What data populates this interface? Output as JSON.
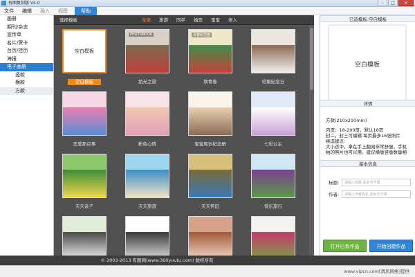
{
  "window": {
    "title": "有图复刻版 V4.0",
    "controls": [
      "–",
      "□",
      "✕"
    ]
  },
  "menu": {
    "items": [
      {
        "label": "文件",
        "state": "normal"
      },
      {
        "label": "编辑",
        "state": "normal"
      },
      {
        "label": "插入",
        "state": "disabled"
      },
      {
        "label": "视图",
        "state": "disabled"
      },
      {
        "label": "帮助",
        "state": "active"
      }
    ]
  },
  "sidebar": {
    "items": [
      {
        "label": "画册",
        "type": "item"
      },
      {
        "label": "期刊/杂志",
        "type": "item"
      },
      {
        "label": "宣传单",
        "type": "item"
      },
      {
        "label": "名片/贺卡",
        "type": "item"
      },
      {
        "label": "台历/挂历",
        "type": "item"
      },
      {
        "label": "海报",
        "type": "item"
      },
      {
        "label": "电子画册",
        "type": "active"
      },
      {
        "label": "竖款",
        "type": "sub"
      },
      {
        "label": "横款",
        "type": "sub"
      },
      {
        "label": "方款",
        "type": "sub-selected"
      }
    ]
  },
  "gallery": {
    "header_label": "选择模板",
    "filters": [
      {
        "label": "全部",
        "active": true
      },
      {
        "label": "旅游",
        "active": false
      },
      {
        "label": "同学",
        "active": false
      },
      {
        "label": "婚恋",
        "active": false
      },
      {
        "label": "宝宝",
        "active": false
      },
      {
        "label": "老人",
        "active": false
      }
    ],
    "templates": [
      {
        "caption": "空白模板",
        "inner_text": "空白模板",
        "selected": true,
        "palette": [
          "#ffffff",
          "#ffffff",
          "#ffffff"
        ]
      },
      {
        "caption": "拍光之旅",
        "inner_text": "PHOTOBOOK",
        "selected": false,
        "palette": [
          "#d9d2c4",
          "#7d6a4f",
          "#bf3f3a"
        ]
      },
      {
        "caption": "致青春",
        "inner_text": "青春纪念册",
        "selected": false,
        "palette": [
          "#efe8c8",
          "#3f8f4a",
          "#c7413b"
        ]
      },
      {
        "caption": "结婚纪念日",
        "inner_text": "",
        "selected": false,
        "palette": [
          "#ece6e0",
          "#8a6a55",
          "#f2f0ee"
        ]
      },
      {
        "caption": "恋爱那点事",
        "inner_text": "",
        "selected": false,
        "palette": [
          "#f7d6e6",
          "#e77fb0",
          "#5a8bd6"
        ]
      },
      {
        "caption": "粉色心情",
        "inner_text": "",
        "selected": false,
        "palette": [
          "#f7e3e8",
          "#f2c6b0",
          "#e2a0b8"
        ]
      },
      {
        "caption": "宝宝周岁纪念册",
        "inner_text": "",
        "selected": false,
        "palette": [
          "#fbf4ea",
          "#e9cfb2",
          "#8a6d55"
        ]
      },
      {
        "caption": "七彩公主",
        "inner_text": "",
        "selected": false,
        "palette": [
          "#dfe9f7",
          "#ffffff",
          "#c9a0d8"
        ]
      },
      {
        "caption": "天天亲子",
        "inner_text": "",
        "selected": false,
        "palette": [
          "#8cc86c",
          "#3e8c3a",
          "#f0d94a"
        ]
      },
      {
        "caption": "天天旅游",
        "inner_text": "",
        "selected": false,
        "palette": [
          "#9ed6f0",
          "#3a8fc8",
          "#f2e3c2"
        ]
      },
      {
        "caption": "天天怀旧",
        "inner_text": "",
        "selected": false,
        "palette": [
          "#d7c07a",
          "#7a6a3a",
          "#3a78b8"
        ]
      },
      {
        "caption": "快乐旅行",
        "inner_text": "",
        "selected": false,
        "palette": [
          "#cfe7f5",
          "#7b3f8f",
          "#5a9a4a"
        ]
      },
      {
        "caption": "",
        "inner_text": "",
        "selected": false,
        "palette": [
          "#e3ecd6",
          "#4a4a4a",
          "#f0f0f0"
        ]
      },
      {
        "caption": "",
        "inner_text": "",
        "selected": false,
        "palette": [
          "#ffffff",
          "#3a3a3a",
          "#dedede"
        ]
      },
      {
        "caption": "",
        "inner_text": "",
        "selected": false,
        "palette": [
          "#d6a38a",
          "#a35a3a",
          "#f0d8c6"
        ]
      },
      {
        "caption": "",
        "inner_text": "",
        "selected": false,
        "palette": [
          "#f4f2ee",
          "#c43a6a",
          "#7da04a"
        ]
      }
    ]
  },
  "right_panel": {
    "selected_head": "已选模板:空白模板",
    "preview_text": "空白模板",
    "details_head": "详情",
    "details_lines": [
      "方款(210x210mm)",
      "内页：18-200页，默认18页",
      "封二，封三可编辑,每页最多16张照片",
      "挑选建议:",
      "大小适中，拿在手上翻阅非常舒服，手机",
      "拍的照片也可以用。建议横版竖版数量相"
    ],
    "info_head": "基本信息",
    "title_label": "标题:",
    "title_placeholder": "请输入标题 此处可不填",
    "author_label": "作者:",
    "author_placeholder": "请输入作者姓名 此处可不填",
    "open_button": "打开已有作品",
    "create_button": "开始创建作品"
  },
  "footer": {
    "copyright": "© 2003-2013 有图网(www.360youtu.com) 版权所有",
    "watermark": "www.vipcn.com[清风网络]提供"
  },
  "colors": {
    "accent_blue": "#2e87d8",
    "selected_orange": "#f08a1b",
    "gallery_bg": "#515151",
    "open_green": "#6db33f"
  }
}
